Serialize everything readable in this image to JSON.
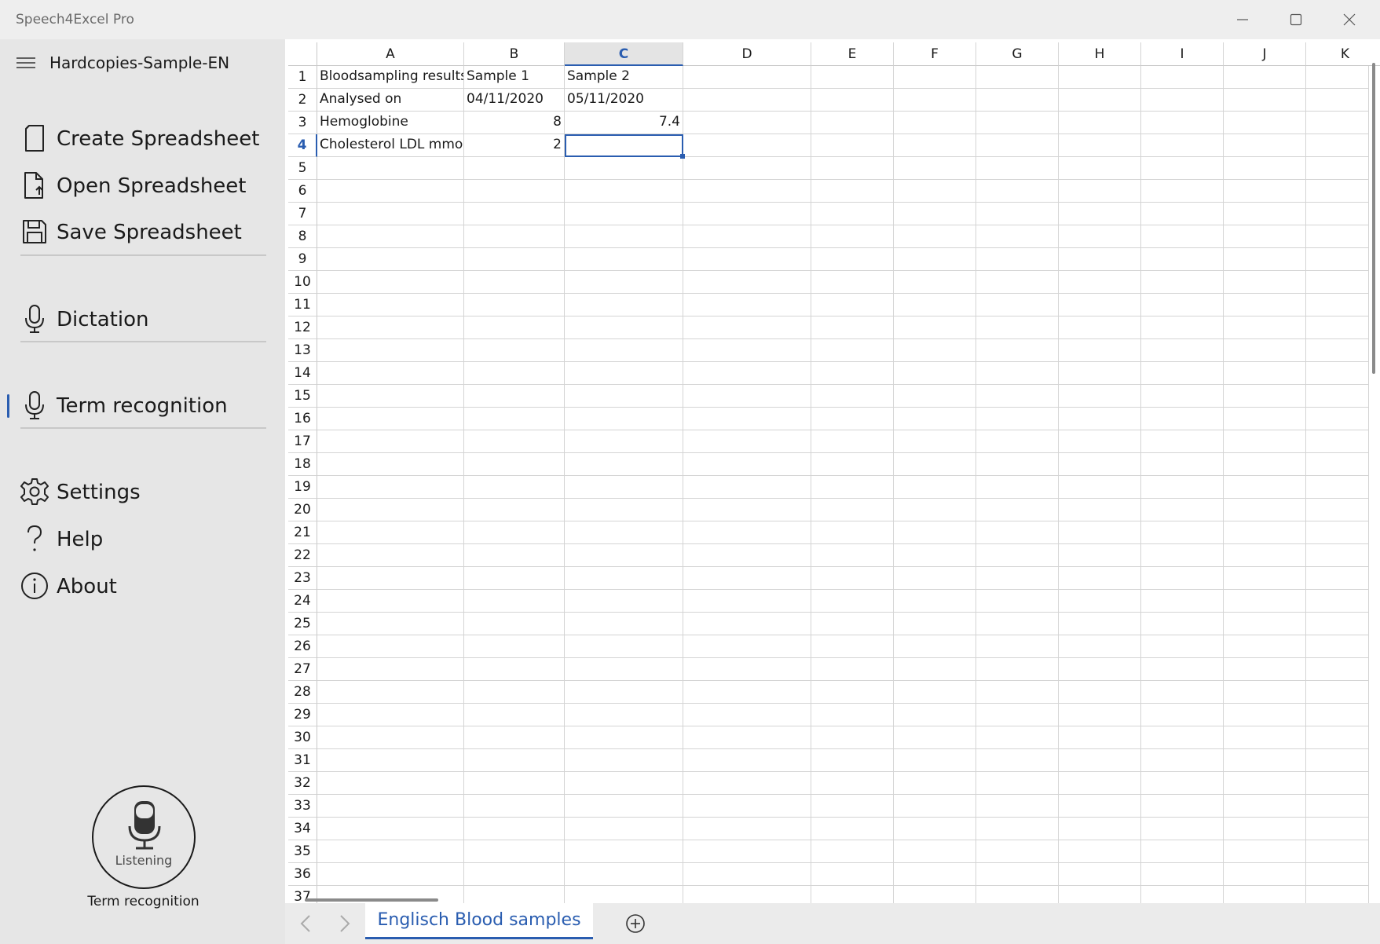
{
  "window": {
    "title": "Speech4Excel Pro"
  },
  "sidebar": {
    "document_title": "Hardcopies-Sample-EN",
    "items": [
      {
        "label": "Create Spreadsheet",
        "icon": "document-icon"
      },
      {
        "label": "Open Spreadsheet",
        "icon": "open-document-icon"
      },
      {
        "label": "Save Spreadsheet",
        "icon": "save-icon"
      },
      {
        "label": "Dictation",
        "icon": "microphone-icon"
      },
      {
        "label": "Term recognition",
        "icon": "microphone-icon"
      },
      {
        "label": "Settings",
        "icon": "gear-icon"
      },
      {
        "label": "Help",
        "icon": "question-icon"
      },
      {
        "label": "About",
        "icon": "info-icon"
      }
    ],
    "active_item": "Term recognition",
    "listen_button": {
      "label": "Listening",
      "caption": "Term recognition"
    }
  },
  "sheet": {
    "columns": [
      "A",
      "B",
      "C",
      "D",
      "E",
      "F",
      "G",
      "H",
      "I",
      "J",
      "K"
    ],
    "rows": [
      "1",
      "2",
      "3",
      "4",
      "5",
      "6",
      "7",
      "8",
      "9",
      "10",
      "11",
      "12",
      "13",
      "14",
      "15",
      "16",
      "17",
      "18",
      "19",
      "20",
      "21",
      "22",
      "23",
      "24",
      "25",
      "26",
      "27",
      "28",
      "29",
      "30",
      "31",
      "32",
      "33",
      "34",
      "35",
      "36",
      "37"
    ],
    "active_column": "C",
    "active_row": "4",
    "cells": {
      "A1": "Bloodsampling results",
      "B1": "Sample 1",
      "C1": "Sample 2",
      "A2": "Analysed on",
      "B2": "04/11/2020",
      "C2": "05/11/2020",
      "A3": "Hemoglobine",
      "B3": "8",
      "C3": "7.4",
      "A4": "Cholesterol LDL mmol",
      "B4": "2",
      "C4": ""
    },
    "numeric_cells": [
      "B3",
      "C3",
      "B4"
    ]
  },
  "tabs": {
    "sheet_name": "Englisch Blood samples"
  },
  "colors": {
    "accent": "#2a5db0",
    "sidebar_bg": "#e6e6e6",
    "grid_line": "#d4d4d4"
  }
}
